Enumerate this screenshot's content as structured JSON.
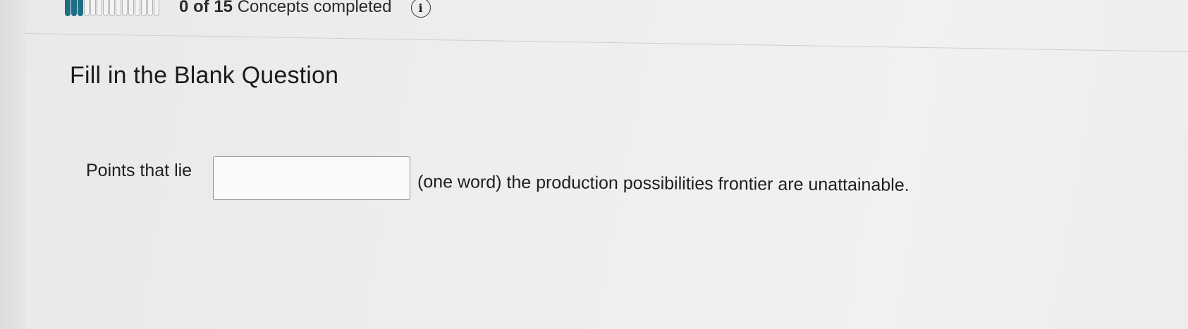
{
  "progress": {
    "total_segments": 15,
    "filled_segments": 3,
    "count_text": "0 of 15",
    "label_text": "Concepts completed",
    "info_glyph": "i",
    "accent_color": "#1c6f85"
  },
  "question": {
    "title": "Fill in the Blank Question",
    "prefix": "Points that lie",
    "blank_value": "",
    "suffix": "(one word) the production possibilities frontier are unattainable."
  }
}
